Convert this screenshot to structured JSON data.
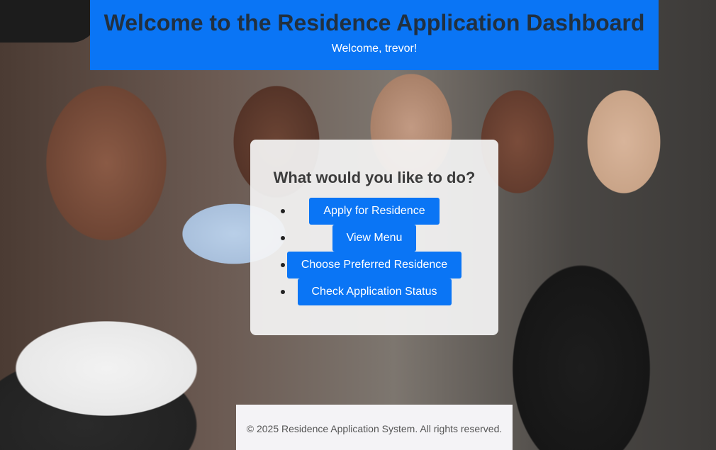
{
  "header": {
    "title": "Welcome to the Residence Application Dashboard",
    "welcome": "Welcome, trevor!"
  },
  "card": {
    "heading": "What would you like to do?",
    "actions": [
      "Apply for Residence",
      "View Menu",
      "Choose Preferred Residence",
      "Check Application Status"
    ]
  },
  "footer": {
    "text": "© 2025 Residence Application System. All rights reserved."
  },
  "colors": {
    "primary": "#0a75f5",
    "title_text": "#213040"
  }
}
